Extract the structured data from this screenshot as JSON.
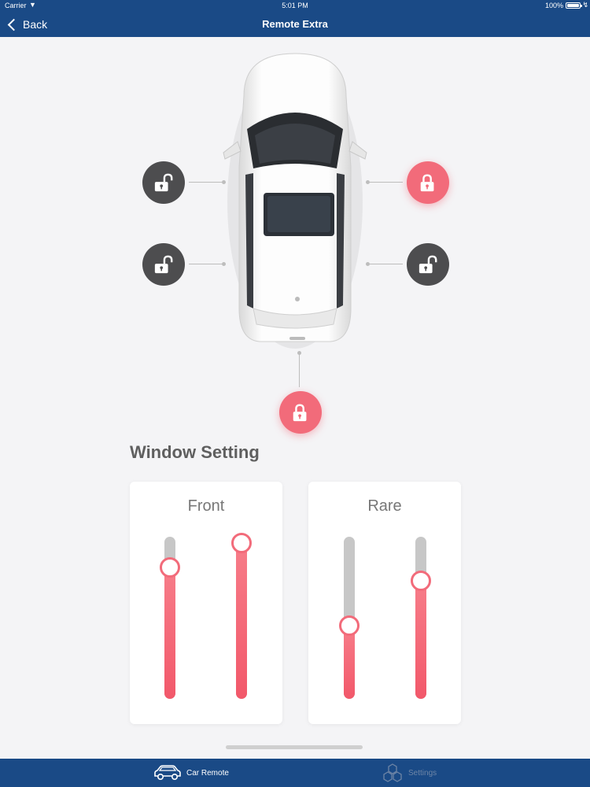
{
  "status_bar": {
    "carrier": "Carrier",
    "time": "5:01 PM",
    "battery": "100%"
  },
  "nav": {
    "back_label": "Back",
    "title": "Remote Extra"
  },
  "locks": {
    "front_left": "unlocked",
    "front_right": "locked",
    "rear_left": "unlocked",
    "rear_right": "unlocked",
    "trunk": "locked"
  },
  "window_setting": {
    "title": "Window Setting",
    "front": {
      "title": "Front",
      "left_level": 0.81,
      "right_level": 0.96
    },
    "rear": {
      "title": "Rare",
      "left_level": 0.45,
      "right_level": 0.73
    }
  },
  "tabbar": {
    "car_remote": {
      "label": "Car Remote",
      "icon": "car-icon"
    },
    "settings": {
      "label": "Settings",
      "icon": "hexagons-icon"
    }
  },
  "colors": {
    "nav_bg": "#1a4a86",
    "accent": "#f26b7a",
    "unlocked": "#4d4d4f"
  }
}
